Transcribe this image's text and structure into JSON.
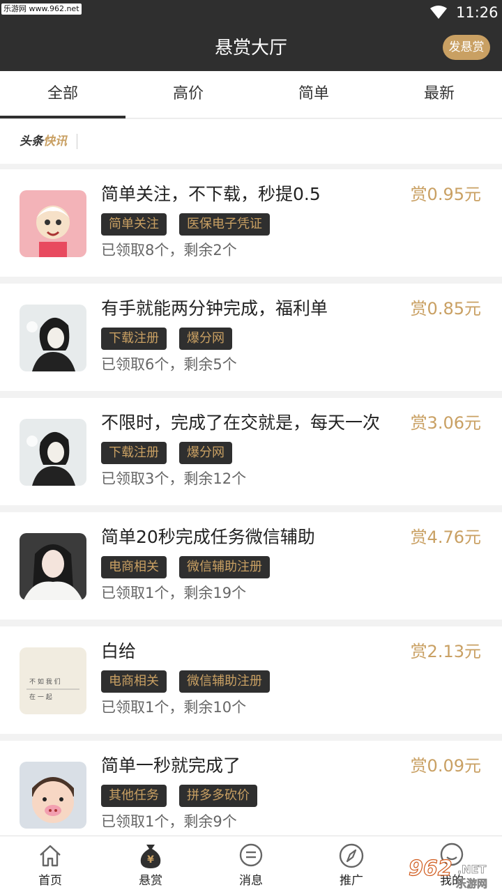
{
  "status_bar": {
    "watermark": "乐游网 www.962.net",
    "time": "11:26"
  },
  "header": {
    "title": "悬赏大厅",
    "post_button": "发悬赏"
  },
  "tabs": [
    {
      "label": "全部",
      "active": true
    },
    {
      "label": "高价",
      "active": false
    },
    {
      "label": "简单",
      "active": false
    },
    {
      "label": "最新",
      "active": false
    }
  ],
  "news": {
    "label_part1": "头条",
    "label_part2": "快讯"
  },
  "tasks": [
    {
      "title": "简单关注，不下载，秒提0.5",
      "reward": "赏0.95元",
      "tags": [
        "简单关注",
        "医保电子凭证"
      ],
      "progress": "已领取8个，剩余2个"
    },
    {
      "title": "有手就能两分钟完成，福利单",
      "reward": "赏0.85元",
      "tags": [
        "下载注册",
        "爆分网"
      ],
      "progress": "已领取6个，剩余5个"
    },
    {
      "title": "不限时，完成了在交就是，每天一次",
      "reward": "赏3.06元",
      "tags": [
        "下载注册",
        "爆分网"
      ],
      "progress": "已领取3个，剩余12个"
    },
    {
      "title": "简单20秒完成任务微信辅助",
      "reward": "赏4.76元",
      "tags": [
        "电商相关",
        "微信辅助注册"
      ],
      "progress": "已领取1个，剩余19个"
    },
    {
      "title": "白给",
      "reward": "赏2.13元",
      "tags": [
        "电商相关",
        "微信辅助注册"
      ],
      "progress": "已领取1个，剩余10个"
    },
    {
      "title": "简单一秒就完成了",
      "reward": "赏0.09元",
      "tags": [
        "其他任务",
        "拼多多砍价"
      ],
      "progress": "已领取1个，剩余9个"
    }
  ],
  "avatar_text": {
    "line1": "不 如 我 们",
    "line2": "在 一 起"
  },
  "bottom_nav": [
    {
      "label": "首页",
      "icon": "home-icon"
    },
    {
      "label": "悬赏",
      "icon": "money-bag-icon",
      "active": true
    },
    {
      "label": "消息",
      "icon": "message-icon"
    },
    {
      "label": "推广",
      "icon": "compass-icon"
    },
    {
      "label": "我的",
      "icon": "user-icon"
    }
  ],
  "corner_watermark": {
    "big": "962",
    "net": ".NET",
    "cn": "乐游网"
  },
  "colors": {
    "dark": "#2f2f2f",
    "accent": "#c9a063"
  }
}
